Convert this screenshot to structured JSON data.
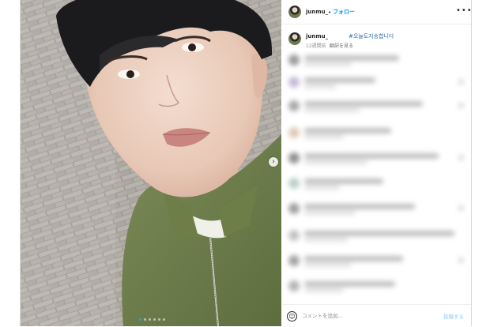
{
  "header": {
    "username": "junmu_",
    "separator": "•",
    "follow_label": "フォロー",
    "more_icon": "more-horizontal-icon"
  },
  "caption": {
    "username": "junmu_",
    "hashtag": "#오늘도지송합니다",
    "time": "12週間前",
    "translate_label": "翻訳を見る"
  },
  "carousel": {
    "slide_count": 6,
    "active_index": 0,
    "next_icon": "chevron-right-icon"
  },
  "comment_box": {
    "emoji_icon": "smile-icon",
    "placeholder": "コメントを追加...",
    "post_label": "投稿する"
  },
  "colors": {
    "accent": "#0095f6",
    "hashtag": "#2a6cb0",
    "post_disabled": "#b3dbff",
    "shirt": "#6b7a4b"
  }
}
